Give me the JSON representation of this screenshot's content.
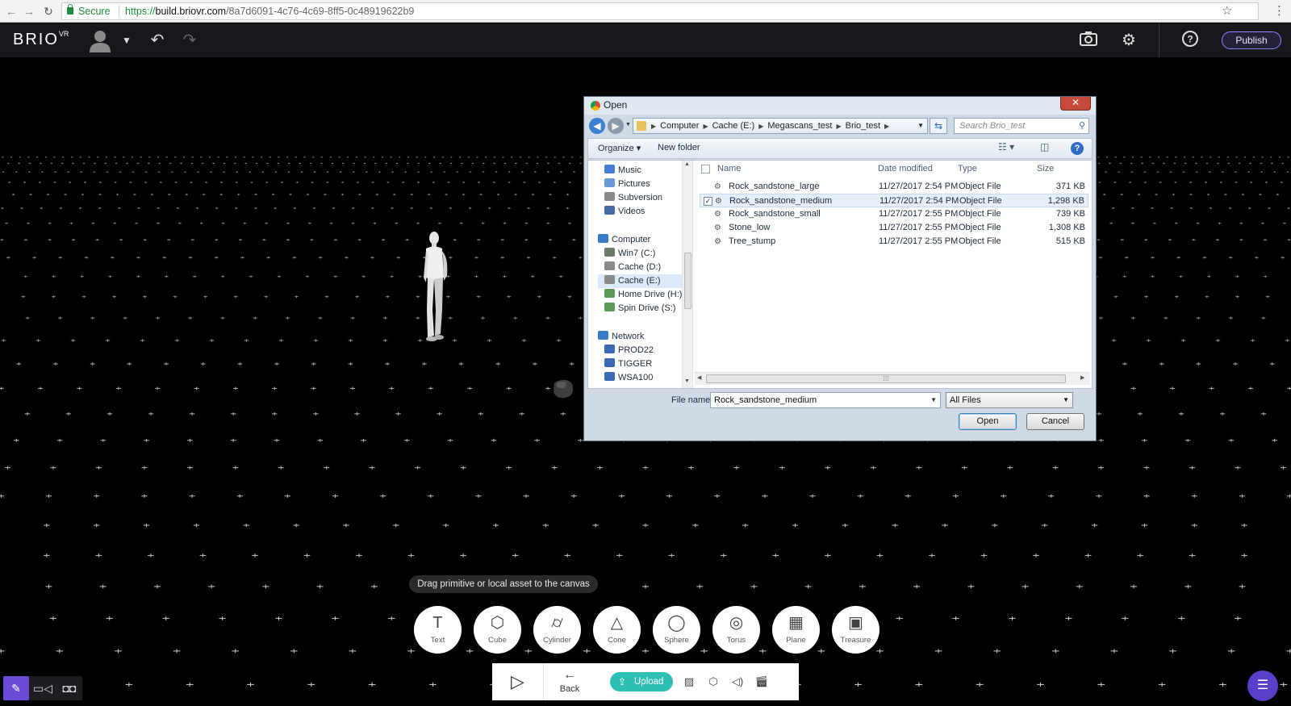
{
  "browser": {
    "secure_label": "Secure",
    "url_prefix": "https://",
    "url_host": "build.briovr.com",
    "url_path": "/8a7d6091-4c76-4c69-8ff5-0c48919622b9"
  },
  "header": {
    "logo": "BRIO",
    "logo_sup": "VR",
    "publish_label": "Publish"
  },
  "dialog": {
    "title": "Open",
    "close_label": "✕",
    "breadcrumbs": [
      "Computer",
      "Cache (E:)",
      "Megascans_test",
      "Brio_test"
    ],
    "search_placeholder": "Search Brio_test",
    "toolbar": {
      "organize": "Organize ▾",
      "new_folder": "New folder"
    },
    "nav_items": [
      {
        "label": "Music",
        "icon": "music-icon",
        "color": "#4a7bd6"
      },
      {
        "label": "Pictures",
        "icon": "pictures-icon",
        "color": "#6a9ad6"
      },
      {
        "label": "Subversion",
        "icon": "folder-icon",
        "color": "#8a8a8a"
      },
      {
        "label": "Videos",
        "icon": "videos-icon",
        "color": "#4a6aa6"
      },
      {
        "label": "Computer",
        "icon": "computer-icon",
        "color": "#3a7ac6"
      },
      {
        "label": "Win7 (C:)",
        "icon": "drive-icon",
        "color": "#6a7a6a"
      },
      {
        "label": "Cache (D:)",
        "icon": "drive-icon",
        "color": "#8a8a8a"
      },
      {
        "label": "Cache (E:)",
        "icon": "drive-icon",
        "color": "#8a8a8a"
      },
      {
        "label": "Home Drive (H:)",
        "icon": "network-drive-icon",
        "color": "#5a9a5a"
      },
      {
        "label": "Spin Drive (S:)",
        "icon": "network-drive-icon",
        "color": "#5a9a5a"
      },
      {
        "label": "Network",
        "icon": "network-icon",
        "color": "#3a7ac6"
      },
      {
        "label": "PROD22",
        "icon": "computer-icon",
        "color": "#3a6ab6"
      },
      {
        "label": "TIGGER",
        "icon": "computer-icon",
        "color": "#3a6ab6"
      },
      {
        "label": "WSA100",
        "icon": "computer-icon",
        "color": "#3a6ab6"
      }
    ],
    "columns": {
      "name": "Name",
      "date": "Date modified",
      "type": "Type",
      "size": "Size"
    },
    "files": [
      {
        "name": "Rock_sandstone_large",
        "date": "11/27/2017 2:54 PM",
        "type": "Object File",
        "size": "371 KB",
        "checked": false
      },
      {
        "name": "Rock_sandstone_medium",
        "date": "11/27/2017 2:54 PM",
        "type": "Object File",
        "size": "1,298 KB",
        "checked": true
      },
      {
        "name": "Rock_sandstone_small",
        "date": "11/27/2017 2:55 PM",
        "type": "Object File",
        "size": "739 KB",
        "checked": false
      },
      {
        "name": "Stone_low",
        "date": "11/27/2017 2:55 PM",
        "type": "Object File",
        "size": "1,308 KB",
        "checked": false
      },
      {
        "name": "Tree_stump",
        "date": "11/27/2017 2:55 PM",
        "type": "Object File",
        "size": "515 KB",
        "checked": false
      }
    ],
    "file_name_label": "File name:",
    "file_name_value": "Rock_sandstone_medium",
    "file_type_value": "All Files",
    "open_label": "Open",
    "cancel_label": "Cancel"
  },
  "canvas": {
    "hint": "Drag primitive or local asset to the canvas",
    "primitives": [
      {
        "label": "Text",
        "icon": "text-icon",
        "glyph": "T"
      },
      {
        "label": "Cube",
        "icon": "cube-icon",
        "glyph": "⬡"
      },
      {
        "label": "Cylinder",
        "icon": "cylinder-icon",
        "glyph": "⌭"
      },
      {
        "label": "Cone",
        "icon": "cone-icon",
        "glyph": "△"
      },
      {
        "label": "Sphere",
        "icon": "sphere-icon",
        "glyph": "◯"
      },
      {
        "label": "Torus",
        "icon": "torus-icon",
        "glyph": "◎"
      },
      {
        "label": "Plane",
        "icon": "plane-icon",
        "glyph": "▦"
      },
      {
        "label": "Treasure",
        "icon": "treasure-icon",
        "glyph": "▣"
      }
    ]
  },
  "dock": {
    "back_label": "Back",
    "upload_label": "Upload"
  }
}
